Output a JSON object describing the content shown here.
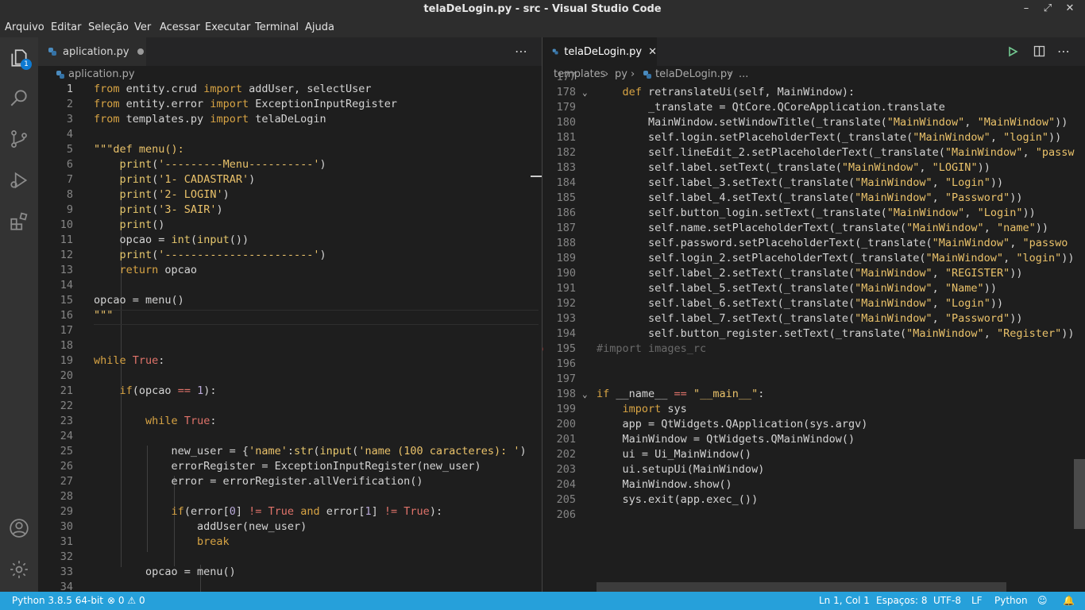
{
  "window": {
    "title": "telaDeLogin.py - src - Visual Studio Code"
  },
  "menu": [
    "Arquivo",
    "Editar",
    "Seleção",
    "Ver",
    "Acessar",
    "Executar",
    "Terminal",
    "Ajuda"
  ],
  "activity": {
    "badge": "1"
  },
  "left_editor": {
    "tab_label": "aplication.py",
    "breadcrumb": "aplication.py",
    "lines": [
      {
        "n": "1",
        "t": "from entity.crud import addUser, selectUser"
      },
      {
        "n": "2",
        "t": "from entity.error import ExceptionInputRegister"
      },
      {
        "n": "3",
        "t": "from templates.py import telaDeLogin"
      },
      {
        "n": "4",
        "t": ""
      },
      {
        "n": "5",
        "t": "\"\"\"def menu():"
      },
      {
        "n": "6",
        "t": "    print('---------Menu----------')"
      },
      {
        "n": "7",
        "t": "    print('1- CADASTRAR')"
      },
      {
        "n": "8",
        "t": "    print('2- LOGIN')"
      },
      {
        "n": "9",
        "t": "    print('3- SAIR')"
      },
      {
        "n": "10",
        "t": "    print()"
      },
      {
        "n": "11",
        "t": "    opcao = int(input())"
      },
      {
        "n": "12",
        "t": "    print('-----------------------')"
      },
      {
        "n": "13",
        "t": "    return opcao"
      },
      {
        "n": "14",
        "t": ""
      },
      {
        "n": "15",
        "t": "opcao = menu()"
      },
      {
        "n": "16",
        "t": "\"\"\""
      },
      {
        "n": "17",
        "t": ""
      },
      {
        "n": "18",
        "t": ""
      },
      {
        "n": "19",
        "t": "while True:"
      },
      {
        "n": "20",
        "t": ""
      },
      {
        "n": "21",
        "t": "    if(opcao == 1):"
      },
      {
        "n": "22",
        "t": ""
      },
      {
        "n": "23",
        "t": "        while True:"
      },
      {
        "n": "24",
        "t": ""
      },
      {
        "n": "25",
        "t": "            new_user = {'name':str(input('name (100 caracteres): ')"
      },
      {
        "n": "26",
        "t": "            errorRegister = ExceptionInputRegister(new_user)"
      },
      {
        "n": "27",
        "t": "            error = errorRegister.allVerification()"
      },
      {
        "n": "28",
        "t": ""
      },
      {
        "n": "29",
        "t": "            if(error[0] != True and error[1] != True):"
      },
      {
        "n": "30",
        "t": "                addUser(new_user)"
      },
      {
        "n": "31",
        "t": "                break"
      },
      {
        "n": "32",
        "t": ""
      },
      {
        "n": "33",
        "t": "        opcao = menu()"
      },
      {
        "n": "34",
        "t": ""
      }
    ]
  },
  "right_editor": {
    "tab_label": "telaDeLogin.py",
    "breadcrumb": [
      "templates",
      "py",
      "telaDeLogin.py",
      "..."
    ],
    "lines": [
      {
        "n": "177",
        "t": ""
      },
      {
        "n": "178",
        "t": "    def retranslateUi(self, MainWindow):"
      },
      {
        "n": "179",
        "t": "        _translate = QtCore.QCoreApplication.translate"
      },
      {
        "n": "180",
        "t": "        MainWindow.setWindowTitle(_translate(\"MainWindow\", \"MainWindow\"))"
      },
      {
        "n": "181",
        "t": "        self.login.setPlaceholderText(_translate(\"MainWindow\", \"login\"))"
      },
      {
        "n": "182",
        "t": "        self.lineEdit_2.setPlaceholderText(_translate(\"MainWindow\", \"passw"
      },
      {
        "n": "183",
        "t": "        self.label.setText(_translate(\"MainWindow\", \"LOGIN\"))"
      },
      {
        "n": "184",
        "t": "        self.label_3.setText(_translate(\"MainWindow\", \"Login\"))"
      },
      {
        "n": "185",
        "t": "        self.label_4.setText(_translate(\"MainWindow\", \"Password\"))"
      },
      {
        "n": "186",
        "t": "        self.button_login.setText(_translate(\"MainWindow\", \"Login\"))"
      },
      {
        "n": "187",
        "t": "        self.name.setPlaceholderText(_translate(\"MainWindow\", \"name\"))"
      },
      {
        "n": "188",
        "t": "        self.password.setPlaceholderText(_translate(\"MainWindow\", \"passwo"
      },
      {
        "n": "189",
        "t": "        self.login_2.setPlaceholderText(_translate(\"MainWindow\", \"login\"))"
      },
      {
        "n": "190",
        "t": "        self.label_2.setText(_translate(\"MainWindow\", \"REGISTER\"))"
      },
      {
        "n": "191",
        "t": "        self.label_5.setText(_translate(\"MainWindow\", \"Name\"))"
      },
      {
        "n": "192",
        "t": "        self.label_6.setText(_translate(\"MainWindow\", \"Login\"))"
      },
      {
        "n": "193",
        "t": "        self.label_7.setText(_translate(\"MainWindow\", \"Password\"))"
      },
      {
        "n": "194",
        "t": "        self.button_register.setText(_translate(\"MainWindow\", \"Register\"))"
      },
      {
        "n": "195",
        "t": "#import images_rc"
      },
      {
        "n": "196",
        "t": ""
      },
      {
        "n": "197",
        "t": ""
      },
      {
        "n": "198",
        "t": "if __name__ == \"__main__\":"
      },
      {
        "n": "199",
        "t": "    import sys"
      },
      {
        "n": "200",
        "t": "    app = QtWidgets.QApplication(sys.argv)"
      },
      {
        "n": "201",
        "t": "    MainWindow = QtWidgets.QMainWindow()"
      },
      {
        "n": "202",
        "t": "    ui = Ui_MainWindow()"
      },
      {
        "n": "203",
        "t": "    ui.setupUi(MainWindow)"
      },
      {
        "n": "204",
        "t": "    MainWindow.show()"
      },
      {
        "n": "205",
        "t": "    sys.exit(app.exec_())"
      },
      {
        "n": "206",
        "t": ""
      }
    ]
  },
  "status": {
    "python": "Python 3.8.5 64-bit",
    "errors": "0",
    "warnings": "0",
    "position": "Ln 1, Col 1",
    "spaces": "Espaços: 8",
    "encoding": "UTF-8",
    "eol": "LF",
    "language": "Python"
  },
  "colors": {
    "status_bar": "#26a0da",
    "editor_bg": "#1e1e1e",
    "tab_bar": "#252526"
  }
}
